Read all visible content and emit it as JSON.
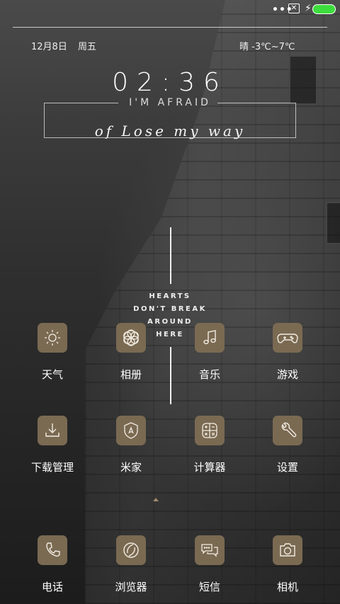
{
  "status_bar": {
    "dots": "•••",
    "sim_icon": "sim-off-icon",
    "charging_icon": "bolt-icon",
    "battery_color": "#3ddc3d"
  },
  "widget": {
    "date": "12月8日",
    "weekday": "周五",
    "weather": "晴 -3℃~7℃",
    "time": "02:36",
    "tagline": "I'M AFRAID",
    "script_text": "of Lose my way",
    "hearts_lines": [
      "HEARTS",
      "DON'T BREAK",
      "AROUND",
      "HERE"
    ]
  },
  "apps": [
    {
      "label": "天气",
      "icon": "sun-icon"
    },
    {
      "label": "相册",
      "icon": "flower-icon"
    },
    {
      "label": "音乐",
      "icon": "music-note-icon"
    },
    {
      "label": "游戏",
      "icon": "gamepad-icon"
    },
    {
      "label": "下载管理",
      "icon": "download-icon"
    },
    {
      "label": "米家",
      "icon": "home-shield-icon"
    },
    {
      "label": "计算器",
      "icon": "calculator-icon"
    },
    {
      "label": "设置",
      "icon": "wrench-icon"
    }
  ],
  "dock": [
    {
      "label": "电话",
      "icon": "phone-icon"
    },
    {
      "label": "浏览器",
      "icon": "browser-icon"
    },
    {
      "label": "短信",
      "icon": "chat-bubbles-icon"
    },
    {
      "label": "相机",
      "icon": "camera-icon"
    }
  ],
  "colors": {
    "icon_bg": "#7a6a52",
    "accent": "#a08a6a"
  }
}
